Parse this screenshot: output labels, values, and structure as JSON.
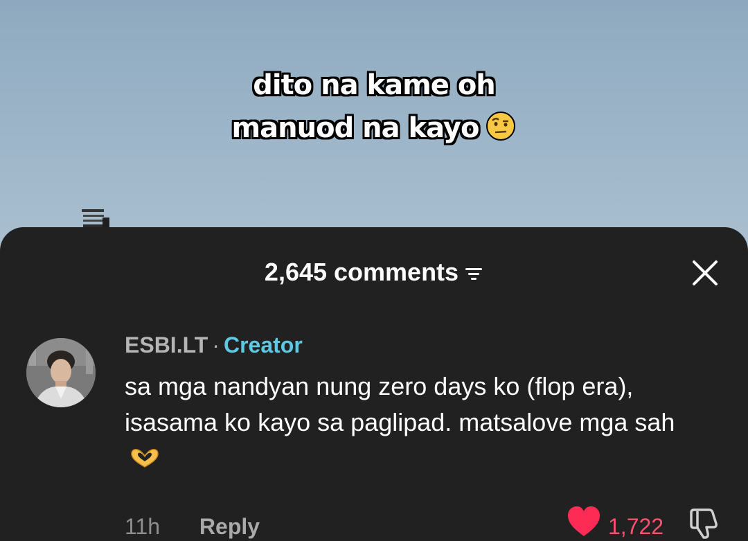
{
  "video": {
    "caption_line1": "dito na kame oh",
    "caption_line2": "manuod na kayo",
    "caption_emoji": "face-with-raised-eyebrow-icon"
  },
  "comments_sheet": {
    "count_label": "2,645 comments",
    "filter_icon": "filter-icon",
    "close_icon": "close-icon"
  },
  "comment": {
    "author": "ESBI.LT",
    "separator": "·",
    "badge": "Creator",
    "text": "sa mga nandyan nung zero days ko (flop era), isasama ko kayo sa paglipad. matsalove mga sah",
    "text_emoji": "heart-hands-icon",
    "time": "11h",
    "reply_label": "Reply",
    "likes": "1,722",
    "liked": true
  },
  "colors": {
    "sheet_bg": "#212121",
    "creator_badge": "#5dc9e2",
    "like_red": "#fe2c55"
  }
}
